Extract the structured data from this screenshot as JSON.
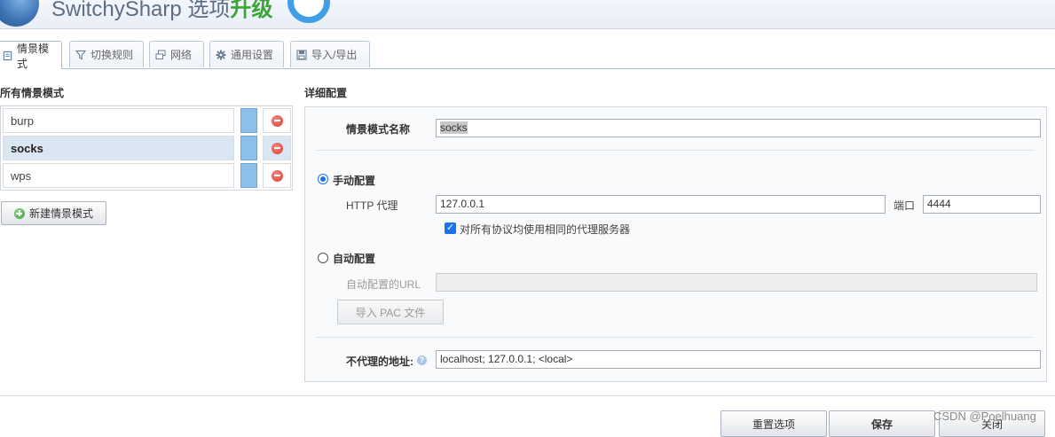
{
  "header": {
    "app_name": "SwitchySharp 选项",
    "upgrade_label": "升级",
    "logo_icon": "globe-icon",
    "upgrade_icon": "ring-icon"
  },
  "tabs": [
    {
      "label": "情景模式",
      "icon": "profile-icon",
      "active": true
    },
    {
      "label": "切换规则",
      "icon": "filter-icon",
      "active": false
    },
    {
      "label": "网络",
      "icon": "network-icon",
      "active": false
    },
    {
      "label": "通用设置",
      "icon": "gear-icon",
      "active": false
    },
    {
      "label": "导入/导出",
      "icon": "save-icon",
      "active": false
    }
  ],
  "profiles": {
    "title": "所有情景模式",
    "items": [
      {
        "name": "burp",
        "color": "#8dbfeb",
        "selected": false
      },
      {
        "name": "socks",
        "color": "#8dbfeb",
        "selected": true
      },
      {
        "name": "wps",
        "color": "#8dbfeb",
        "selected": false
      }
    ],
    "new_button": "新建情景模式"
  },
  "detail": {
    "title": "详细配置",
    "name_label": "情景模式名称",
    "name_value": "socks",
    "manual": {
      "label": "手动配置",
      "selected": true,
      "http_label": "HTTP 代理",
      "http_value": "127.0.0.1",
      "port_label": "端口",
      "port_value": "4444",
      "same_proxy_label": "对所有协议均使用相同的代理服务器",
      "same_proxy_checked": true
    },
    "auto": {
      "label": "自动配置",
      "selected": false,
      "url_label": "自动配置的URL",
      "url_value": "",
      "import_pac": "导入 PAC 文件"
    },
    "bypass_label": "不代理的地址:",
    "bypass_value": "localhost; 127.0.0.1; <local>"
  },
  "footer": {
    "reset": "重置选项",
    "save": "保存",
    "close": "关闭"
  },
  "watermark": "CSDN @Poelhuang"
}
